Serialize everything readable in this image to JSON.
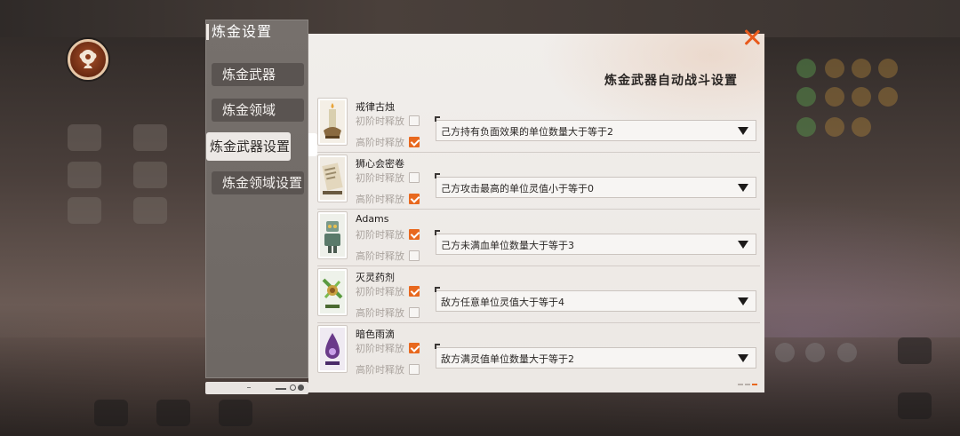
{
  "nav": {
    "title": "炼金设置",
    "items": [
      {
        "label": "炼金武器",
        "active": false
      },
      {
        "label": "炼金领域",
        "active": false
      },
      {
        "label": "炼金武器设置",
        "active": true
      },
      {
        "label": "炼金领域设置",
        "active": false
      }
    ]
  },
  "main": {
    "title": "炼金武器自动战斗设置",
    "weapons": [
      {
        "name": "戒律古烛",
        "opt1_label": "初阶时释放",
        "opt1_checked": false,
        "opt2_label": "高阶时释放",
        "opt2_checked": true,
        "condition": "己方持有负面效果的单位数量大于等于2"
      },
      {
        "name": "狮心会密卷",
        "opt1_label": "初阶时释放",
        "opt1_checked": false,
        "opt2_label": "高阶时释放",
        "opt2_checked": true,
        "condition": "己方攻击最高的单位灵值小于等于0"
      },
      {
        "name": "Adams",
        "opt1_label": "初阶时释放",
        "opt1_checked": true,
        "opt2_label": "高阶时释放",
        "opt2_checked": false,
        "condition": "己方未满血单位数量大于等于3"
      },
      {
        "name": "灭灵药剂",
        "opt1_label": "初阶时释放",
        "opt1_checked": true,
        "opt2_label": "高阶时释放",
        "opt2_checked": false,
        "condition": "敌方任意单位灵值大于等于4"
      },
      {
        "name": "暗色雨滴",
        "opt1_label": "初阶时释放",
        "opt1_checked": true,
        "opt2_label": "高阶时释放",
        "opt2_checked": false,
        "condition": "敌方满灵值单位数量大于等于2"
      }
    ]
  },
  "colors": {
    "accent": "#e8681e",
    "close": "#e85a1c",
    "panel": "#f1eeeb",
    "nav": "#76706c"
  },
  "icons": {
    "close": "close-icon",
    "dropdown": "chevron-down-icon",
    "badge": "alchemy-tree-icon"
  }
}
